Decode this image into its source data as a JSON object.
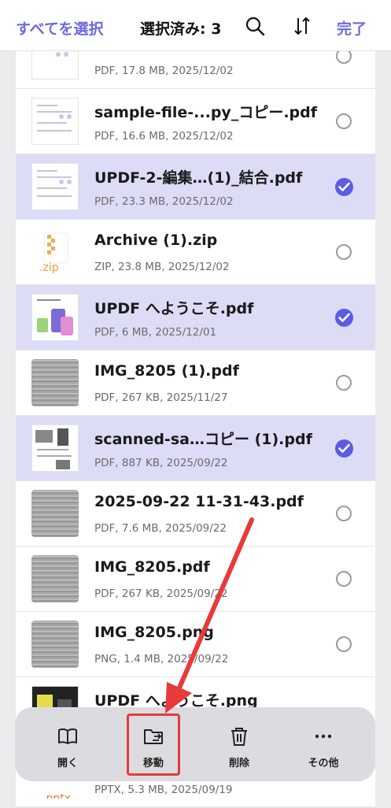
{
  "header": {
    "select_all": "すべてを選択",
    "selected_count": "選択済み: 3",
    "search_icon": "search-icon",
    "sort_icon": "sort-icon",
    "done": "完了"
  },
  "files": [
    {
      "name": "",
      "meta": "PDF, 17.8 MB, 2025/12/02",
      "selected": false,
      "thumb": "doc"
    },
    {
      "name": "sample-file-...py_コピー.pdf",
      "meta": "PDF, 16.6 MB, 2025/12/02",
      "selected": false,
      "thumb": "doc"
    },
    {
      "name": "UPDF-2-編集…(1)_結合.pdf",
      "meta": "PDF, 23.3 MB, 2025/12/02",
      "selected": true,
      "thumb": "doc"
    },
    {
      "name": "Archive (1).zip",
      "meta": "ZIP, 23.8 MB, 2025/12/02",
      "selected": false,
      "thumb": "zip",
      "thumb_label": ".zip"
    },
    {
      "name": "UPDF へようこそ.pdf",
      "meta": "PDF, 6 MB, 2025/12/01",
      "selected": true,
      "thumb": "doc"
    },
    {
      "name": "IMG_8205 (1).pdf",
      "meta": "PDF, 267 KB, 2025/11/27",
      "selected": false,
      "thumb": "photo"
    },
    {
      "name": "scanned-sa…コピー (1).pdf",
      "meta": "PDF, 887 KB, 2025/09/22",
      "selected": true,
      "thumb": "doc"
    },
    {
      "name": "2025-09-22 11-31-43.pdf",
      "meta": "PDF, 7.6 MB, 2025/09/22",
      "selected": false,
      "thumb": "photo"
    },
    {
      "name": "IMG_8205.pdf",
      "meta": "PDF, 267 KB, 2025/09/22",
      "selected": false,
      "thumb": "photo"
    },
    {
      "name": "IMG_8205.png",
      "meta": "PNG, 1.4 MB, 2025/09/22",
      "selected": false,
      "thumb": "photo"
    },
    {
      "name": "UPDF へようこそ.png",
      "meta": "",
      "selected": false,
      "thumb": "doc"
    },
    {
      "name": "",
      "meta": "PPTX, 5.3 MB, 2025/09/19",
      "selected": false,
      "thumb": "pptx",
      "thumb_label": ".pptx"
    }
  ],
  "toolbar": {
    "open": "開く",
    "move": "移動",
    "delete": "削除",
    "more": "その他"
  },
  "colors": {
    "accent": "#5b5be3",
    "selected_row": "#dcdcf7",
    "annotation": "#e83a3a"
  }
}
